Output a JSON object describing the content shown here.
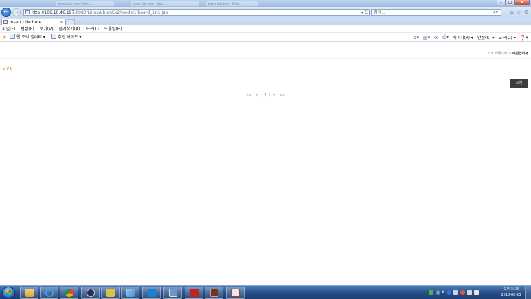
{
  "browser": {
    "background_tabs": [
      "Insert title here - Wind...",
      "Insert title here - Wind...",
      "Insert title here - Wind..."
    ],
    "address": {
      "host": "http://106.10.46.197",
      "path": ":8080/LinuxAlbumEx2/model1/board_list1.jsp",
      "tools": "▾ C"
    },
    "search": {
      "placeholder": "검색...",
      "icon": "search-icon"
    },
    "tab": {
      "title": "Insert title here",
      "close": "×"
    },
    "menu": [
      "파일(F)",
      "편집(E)",
      "보기(V)",
      "즐겨찾기(A)",
      "도구(T)",
      "도움말(H)"
    ],
    "favorites": {
      "links": [
        "웹 조각 갤러리 ▾",
        "추천 사이트 ▾"
      ]
    },
    "commands": [
      "페이지(P) ▾",
      "안전(S) ▾",
      "도구(O) ▾"
    ]
  },
  "page": {
    "breadcrumb": {
      "home": "⌂",
      "path": " > 커뮤니티 > ",
      "current": "애완견리뷰"
    },
    "board_link": "유리",
    "write_button": "쓰기",
    "pagination": {
      "first": "<<",
      "prev": "<",
      "current": "[ 1 ]",
      "next": ">",
      "last": ">>"
    }
  },
  "taskbar": {
    "apps": [
      "explorer",
      "internet-explorer",
      "chrome",
      "app",
      "app",
      "app",
      "visual-studio-code",
      "app",
      "filezilla",
      "app",
      "app"
    ],
    "tray": {
      "lang": "漢",
      "lang2": "A"
    },
    "clock": {
      "time": "오후 3:03",
      "date": "2018-08-23"
    }
  },
  "colors": {
    "accent": "#1d5fb5",
    "write_button": "#3d3d3d",
    "taskbar": "#254e86"
  }
}
